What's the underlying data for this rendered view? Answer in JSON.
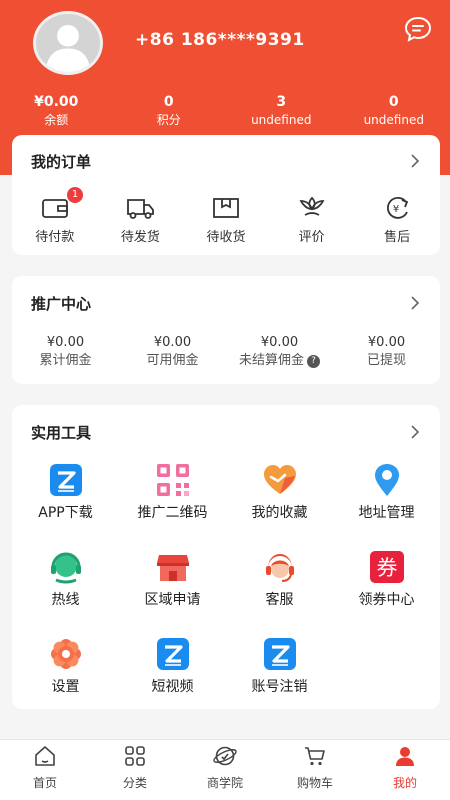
{
  "profile": {
    "phone": "+86 186****9391"
  },
  "stats": [
    {
      "value": "¥0.00",
      "label": "余额"
    },
    {
      "value": "0",
      "label": "积分"
    },
    {
      "value": "3",
      "label": "undefined"
    },
    {
      "value": "0",
      "label": "undefined"
    }
  ],
  "orders": {
    "title": "我的订单",
    "items": [
      {
        "icon": "wallet-icon",
        "label": "待付款",
        "badge": "1"
      },
      {
        "icon": "truck-icon",
        "label": "待发货"
      },
      {
        "icon": "package-icon",
        "label": "待收货"
      },
      {
        "icon": "flower-icon",
        "label": "评价"
      },
      {
        "icon": "refund-icon",
        "label": "售后"
      }
    ]
  },
  "promotion": {
    "title": "推广中心",
    "items": [
      {
        "value": "¥0.00",
        "label": "累计佣金"
      },
      {
        "value": "¥0.00",
        "label": "可用佣金"
      },
      {
        "value": "¥0.00",
        "label": "未结算佣金",
        "help": "?"
      },
      {
        "value": "¥0.00",
        "label": "已提现"
      }
    ]
  },
  "tools": {
    "title": "实用工具",
    "items": [
      {
        "icon": "app-download-icon",
        "label": "APP下载"
      },
      {
        "icon": "qr-code-icon",
        "label": "推广二维码"
      },
      {
        "icon": "heart-icon",
        "label": "我的收藏"
      },
      {
        "icon": "location-pin-icon",
        "label": "地址管理"
      },
      {
        "icon": "headset-icon",
        "label": "热线"
      },
      {
        "icon": "store-icon",
        "label": "区域申请"
      },
      {
        "icon": "customer-service-icon",
        "label": "客服"
      },
      {
        "icon": "coupon-icon",
        "label": "领券中心",
        "glyph": "券"
      },
      {
        "icon": "settings-icon",
        "label": "设置"
      },
      {
        "icon": "short-video-icon",
        "label": "短视频"
      },
      {
        "icon": "account-cancel-icon",
        "label": "账号注销"
      }
    ]
  },
  "tabbar": [
    {
      "icon": "home-icon",
      "label": "首页"
    },
    {
      "icon": "category-icon",
      "label": "分类"
    },
    {
      "icon": "academy-icon",
      "label": "商学院"
    },
    {
      "icon": "cart-icon",
      "label": "购物车"
    },
    {
      "icon": "profile-icon",
      "label": "我的",
      "active": true
    }
  ],
  "colors": {
    "brand": "#ef4f32",
    "active_tab": "#e93b2f",
    "badge": "#ef3b3b"
  }
}
